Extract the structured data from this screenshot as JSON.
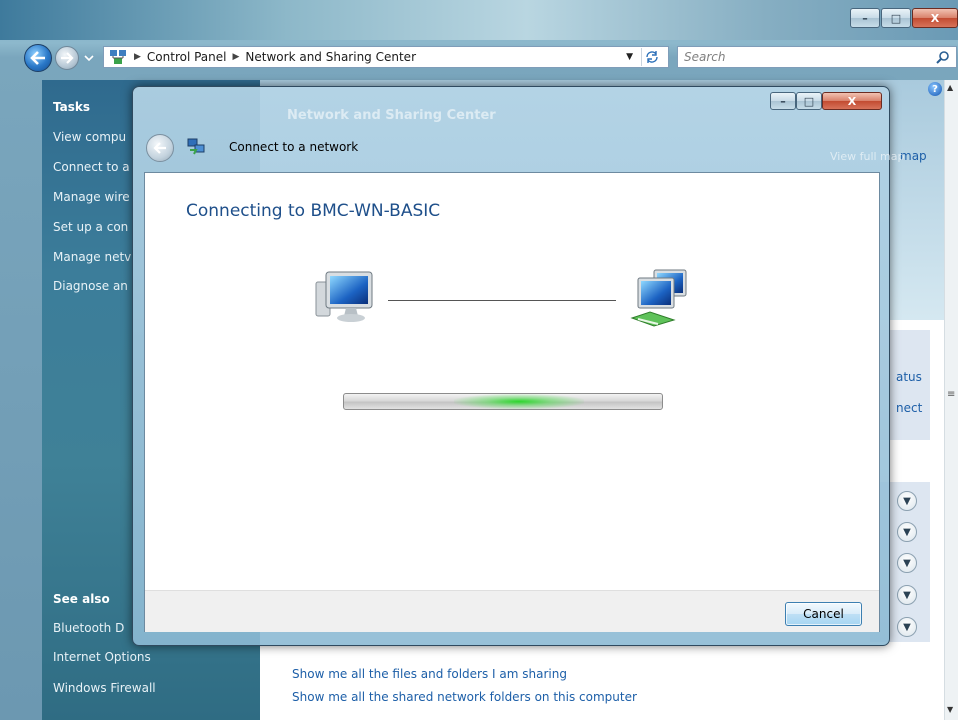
{
  "window": {
    "caption_buttons": {
      "minimize": "–",
      "maximize": "□",
      "close": "X"
    }
  },
  "navigation": {
    "back_icon": "back-arrow-icon",
    "forward_icon": "forward-arrow-icon",
    "breadcrumb": [
      "Control Panel",
      "Network and Sharing Center"
    ],
    "search_placeholder": "Search"
  },
  "task_pane": {
    "tasks_header": "Tasks",
    "tasks": [
      "View compu",
      "Connect to a",
      "Manage wire",
      "Set up a con",
      "Manage netv",
      "Diagnose an"
    ],
    "see_also_header": "See also",
    "see_also": [
      "Bluetooth D",
      "Internet Options",
      "Windows Firewall"
    ]
  },
  "main_content": {
    "map_link": "map",
    "status_link": "atus",
    "connect_link": "nect",
    "bottom_links": [
      "Show me all the files and folders I am sharing",
      "Show me all the shared network folders on this computer"
    ]
  },
  "dialog": {
    "background_title": "Network and Sharing Center",
    "background_map_link": "View full map",
    "title": "Connect to a network",
    "heading": "Connecting to BMC-WN-BASIC",
    "cancel_label": "Cancel",
    "progress": {
      "state": "indeterminate",
      "color": "#2ad12a"
    }
  },
  "colors": {
    "accent": "#1d5fa8",
    "heading_blue": "#1e4f8a",
    "task_pane": "#3c7d9a"
  }
}
